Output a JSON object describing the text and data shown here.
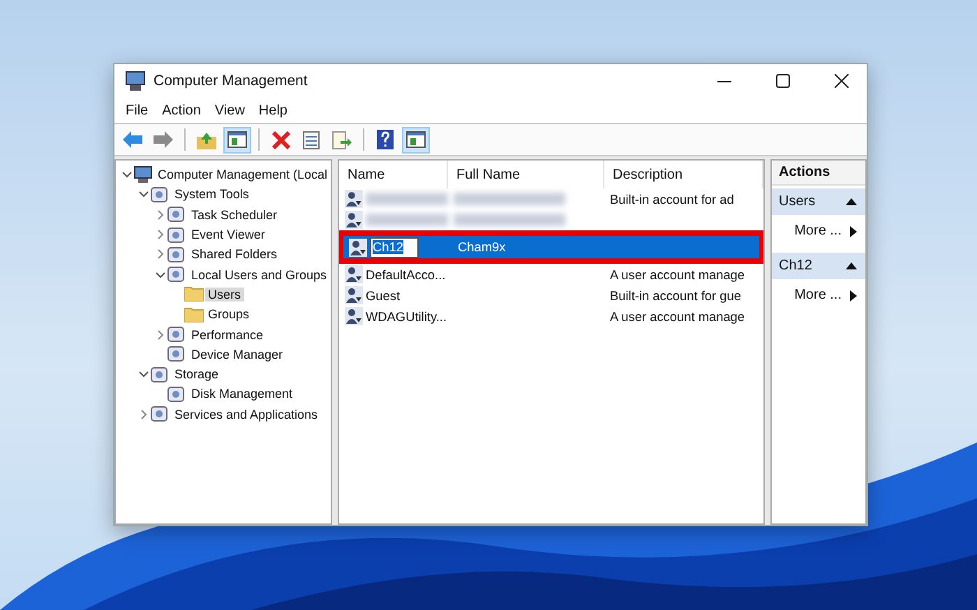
{
  "window": {
    "title": "Computer Management"
  },
  "menu": [
    "File",
    "Action",
    "View",
    "Help"
  ],
  "toolbar": [
    {
      "pressed": false
    },
    {
      "pressed": false
    },
    {
      "pressed": false
    },
    {
      "pressed": true
    },
    {
      "pressed": false
    },
    {
      "pressed": false
    },
    {
      "pressed": false
    },
    {
      "pressed": false
    },
    {
      "pressed": true
    }
  ],
  "tree": [
    {
      "label": "Computer Management (Local",
      "expanded": true,
      "selected": false,
      "children": [
        {
          "label": "System Tools",
          "expanded": true,
          "selected": false,
          "children": [
            {
              "label": "Task Scheduler",
              "expanded": false,
              "selected": false
            },
            {
              "label": "Event Viewer",
              "expanded": false,
              "selected": false
            },
            {
              "label": "Shared Folders",
              "expanded": false,
              "selected": false
            },
            {
              "label": "Local Users and Groups",
              "expanded": true,
              "selected": false,
              "children": [
                {
                  "label": "Users",
                  "selected": true
                },
                {
                  "label": "Groups",
                  "selected": false
                }
              ]
            },
            {
              "label": "Performance",
              "expanded": false,
              "selected": false
            },
            {
              "label": "Device Manager",
              "selected": false
            }
          ]
        },
        {
          "label": "Storage",
          "expanded": true,
          "selected": false,
          "children": [
            {
              "label": "Disk Management",
              "selected": false
            }
          ]
        },
        {
          "label": "Services and Applications",
          "expanded": false,
          "selected": false
        }
      ]
    }
  ],
  "table": {
    "columns": [
      "Name",
      "Full Name",
      "Description"
    ],
    "rows": [
      {
        "kind": "blurred",
        "description": "Built-in account for ad",
        "selected": false
      },
      {
        "kind": "blurred",
        "selected": false
      },
      {
        "kind": "user",
        "name": "Ch12",
        "full_name": "Cham9x",
        "selected": true,
        "editing": true,
        "highlighted": true
      },
      {
        "kind": "user",
        "name": "DefaultAcco...",
        "description": "A user account manage",
        "selected": false,
        "editing": false,
        "highlighted": false
      },
      {
        "kind": "user",
        "name": "Guest",
        "description": "Built-in account for gue",
        "selected": false,
        "editing": false,
        "highlighted": false
      },
      {
        "kind": "user",
        "name": "WDAGUtility...",
        "description": "A user account manage",
        "selected": false,
        "editing": false,
        "highlighted": false
      }
    ]
  },
  "actions": {
    "title": "Actions",
    "sections": [
      {
        "title": "Users",
        "expanded": true,
        "items": [
          "More ..."
        ]
      },
      {
        "title": "Ch12",
        "expanded": true,
        "items": [
          "More ..."
        ]
      }
    ]
  }
}
